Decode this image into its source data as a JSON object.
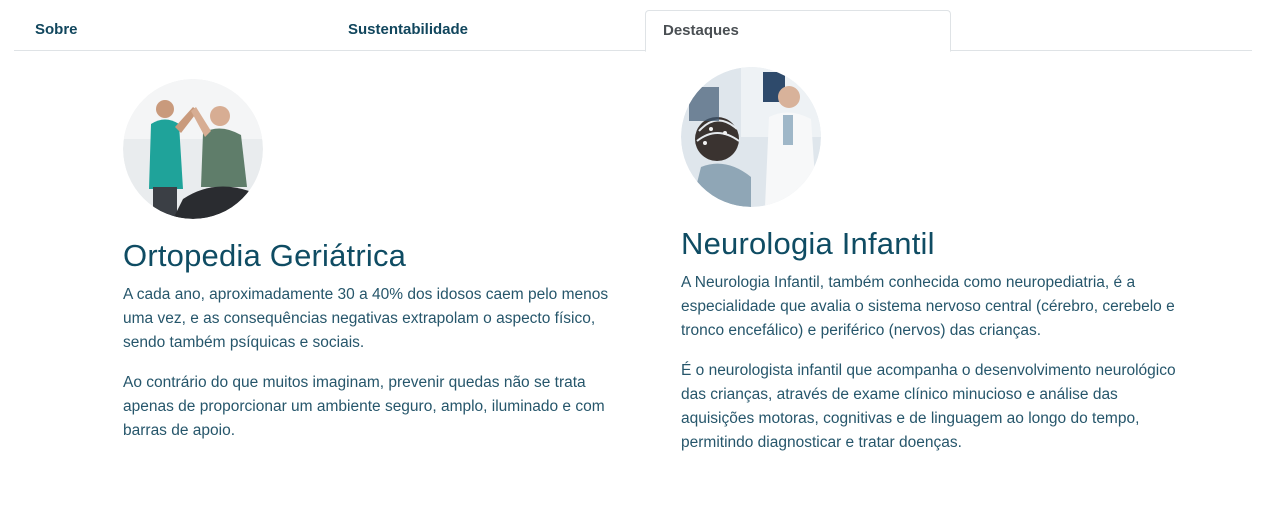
{
  "tabs": [
    {
      "label": "Sobre"
    },
    {
      "label": "Sustentabilidade"
    },
    {
      "label": "Destaques",
      "active": true
    }
  ],
  "cards": [
    {
      "image_icon": "photo-physiotherapy-elderly",
      "title": "Ortopedia Geriátrica",
      "paragraphs": [
        "A cada ano, aproximadamente 30 a 40% dos idosos caem pelo menos uma vez, e as consequências negativas extrapolam o aspecto físico, sendo também psíquicas e sociais.",
        "Ao contrário do que muitos imaginam, prevenir quedas não se trata apenas de proporcionar um ambiente seguro, amplo, iluminado e com barras de apoio."
      ]
    },
    {
      "image_icon": "photo-child-eeg-doctor",
      "title": "Neurologia Infantil",
      "paragraphs": [
        "A Neurologia Infantil, também conhecida como neuropediatria, é a especialidade que avalia o sistema nervoso central (cérebro, cerebelo e tronco encefálico) e periférico (nervos) das crianças.",
        "É o neurologista infantil que acompanha o desenvolvimento neurológico das crianças, através de exame clínico minucioso e análise das aquisições motoras, cognitivas e de linguagem ao longo do tempo, permitindo diagnosticar e tratar doenças."
      ]
    }
  ],
  "colors": {
    "heading": "#0f4c63",
    "body_text": "#26566b",
    "tab_text": "#11465d",
    "border": "#dfe3e6"
  }
}
